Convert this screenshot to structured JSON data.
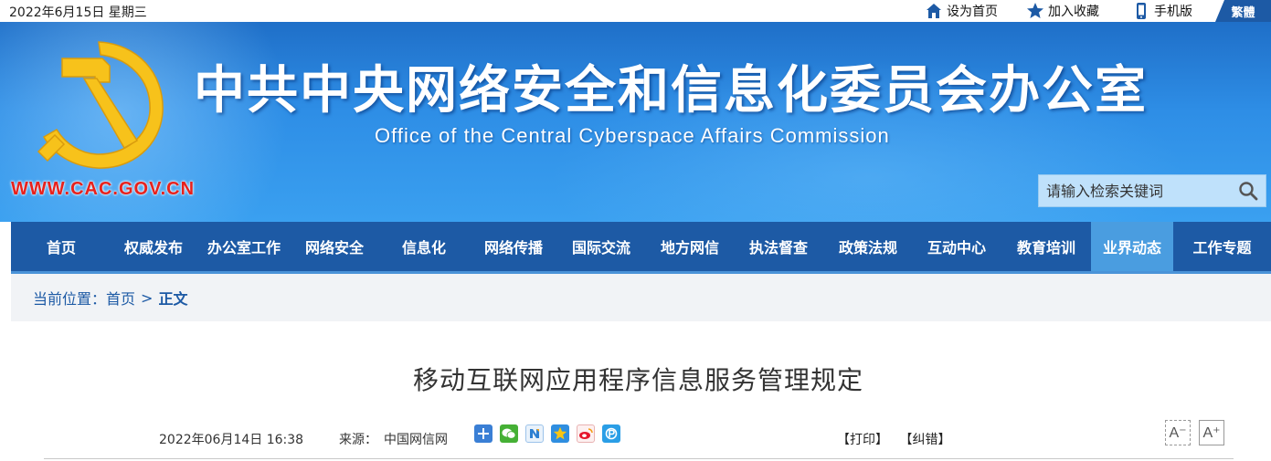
{
  "topbar": {
    "date": "2022年6月15日 星期三",
    "set_home": "设为首页",
    "favorite": "加入收藏",
    "mobile": "手机版",
    "traditional": "繁體"
  },
  "banner": {
    "title_cn": "中共中央网络安全和信息化委员会办公室",
    "title_en": "Office of the Central Cyberspace Affairs Commission",
    "url": "WWW.CAC.GOV.CN",
    "search_placeholder": "请输入检索关键词"
  },
  "nav": {
    "items": [
      {
        "label": "首页"
      },
      {
        "label": "权威发布"
      },
      {
        "label": "办公室工作"
      },
      {
        "label": "网络安全"
      },
      {
        "label": "信息化"
      },
      {
        "label": "网络传播"
      },
      {
        "label": "国际交流"
      },
      {
        "label": "地方网信"
      },
      {
        "label": "执法督查"
      },
      {
        "label": "政策法规"
      },
      {
        "label": "互动中心"
      },
      {
        "label": "教育培训"
      },
      {
        "label": "业界动态"
      },
      {
        "label": "工作专题"
      }
    ],
    "active": "业界动态"
  },
  "breadcrumb": {
    "prefix": "当前位置：",
    "home": "首页",
    "sep": ">",
    "current": "正文"
  },
  "article": {
    "title": "移动互联网应用程序信息服务管理规定",
    "datetime": "2022年06月14日 16:38",
    "source_label": "来源：",
    "source": "中国网信网",
    "print": "【打印】",
    "correct": "【纠错】",
    "font_smaller": "A⁻",
    "font_larger": "A⁺"
  },
  "colors": {
    "nav_bg": "#1d5aa5",
    "nav_active": "#4a9de0",
    "url_red": "#e8211c",
    "emblem_gold": "#f7c21b"
  },
  "icons": {
    "set_home": "home-icon",
    "favorite": "star-icon",
    "mobile": "phone-icon",
    "search": "search-icon",
    "share": [
      "plus-share-icon",
      "wechat-icon",
      "n-share-icon",
      "qzone-icon",
      "weibo-icon",
      "p-share-icon"
    ]
  }
}
